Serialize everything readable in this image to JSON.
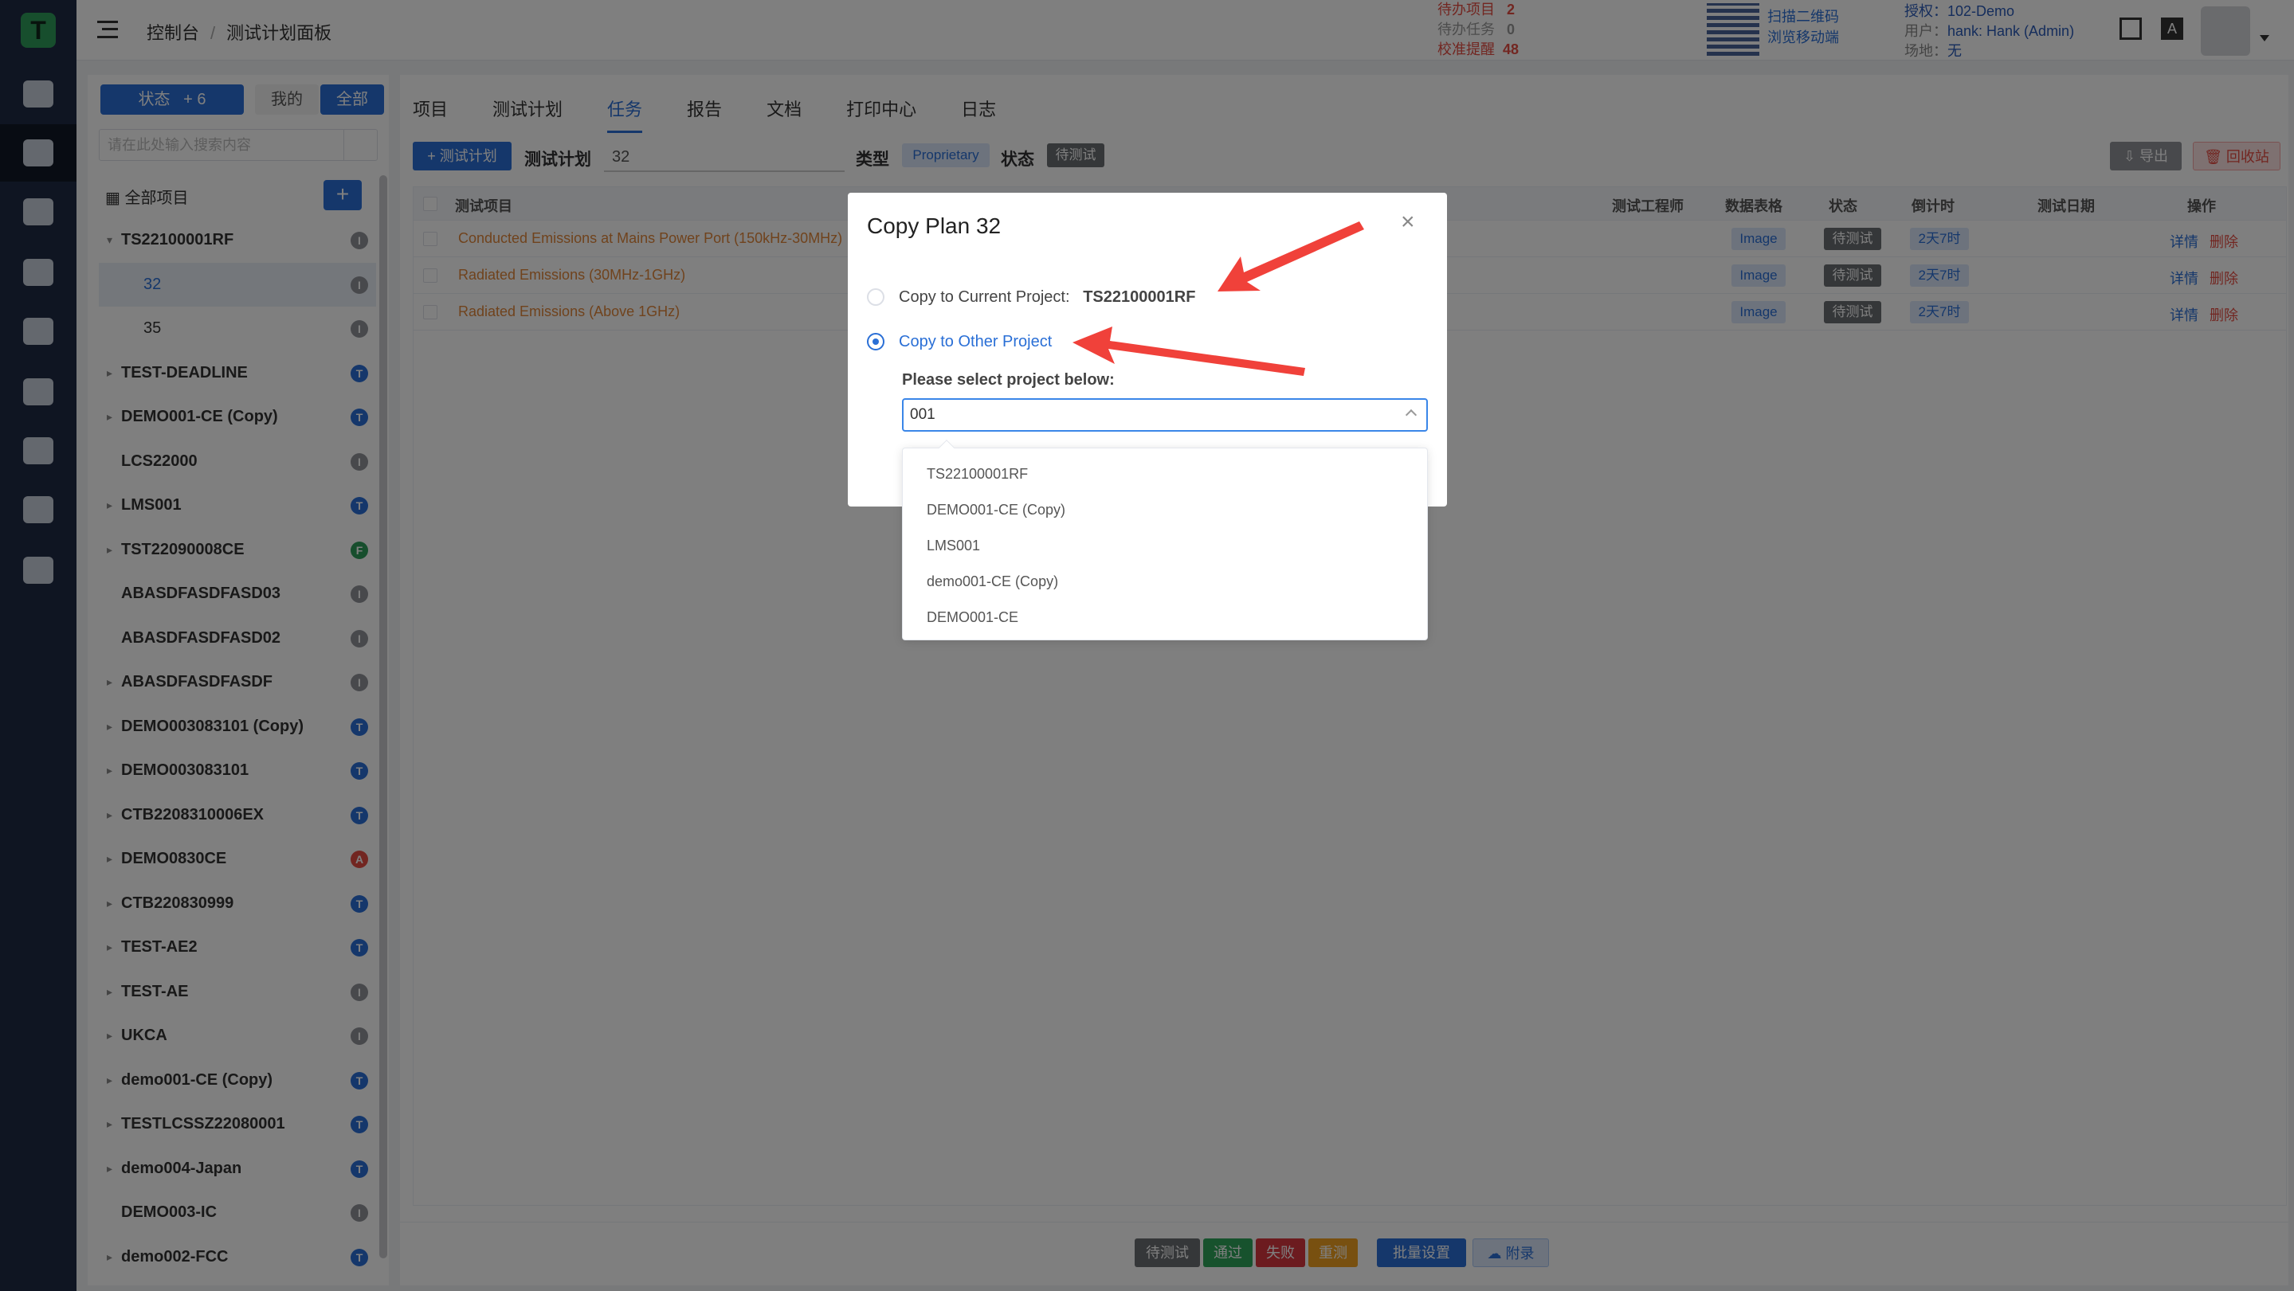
{
  "rail": {
    "logo": "T"
  },
  "header": {
    "breadcrumb": [
      "控制台",
      "测试计划面板"
    ],
    "stats": [
      {
        "label": "待办项目",
        "value": "2"
      },
      {
        "label": "待办任务",
        "value": "0"
      },
      {
        "label": "校准提醒",
        "value": "48"
      }
    ],
    "qr_text": [
      "扫描二维码",
      "浏览移动端"
    ],
    "license": "授权：102-Demo",
    "user_label": "用户：",
    "user_value": "hank: Hank (Admin)",
    "site_label": "场地：",
    "site_value": "无",
    "lang_badge": "A"
  },
  "sidebar": {
    "filter_status": "状态",
    "filter_count": "+ 6",
    "filter_mine": "我的",
    "filter_all": "全部",
    "search_placeholder": "请在此处输入搜索内容",
    "all_projects": "全部项目",
    "add_label": "+",
    "items": [
      {
        "label": "TS22100001RF",
        "badge": "I",
        "color": "#909399",
        "expanded": true
      },
      {
        "label": "32",
        "badge": "I",
        "color": "#909399",
        "child": true,
        "selected": true
      },
      {
        "label": "35",
        "badge": "I",
        "color": "#909399",
        "child": true
      },
      {
        "label": "TEST-DEADLINE",
        "badge": "T",
        "color": "#2a6fd6"
      },
      {
        "label": "DEMO001-CE (Copy)",
        "badge": "T",
        "color": "#2a6fd6"
      },
      {
        "label": "LCS22000",
        "badge": "I",
        "color": "#909399",
        "noarrow": true
      },
      {
        "label": "LMS001",
        "badge": "T",
        "color": "#2a6fd6"
      },
      {
        "label": "TST22090008CE",
        "badge": "F",
        "color": "#2f9d5b"
      },
      {
        "label": "ABASDFASDFASD03",
        "badge": "I",
        "color": "#909399",
        "noarrow": true
      },
      {
        "label": "ABASDFASDFASD02",
        "badge": "I",
        "color": "#909399",
        "noarrow": true
      },
      {
        "label": "ABASDFASDFASDF",
        "badge": "I",
        "color": "#909399"
      },
      {
        "label": "DEMO003083101 (Copy)",
        "badge": "T",
        "color": "#2a6fd6"
      },
      {
        "label": "DEMO003083101",
        "badge": "T",
        "color": "#2a6fd6"
      },
      {
        "label": "CTB2208310006EX",
        "badge": "T",
        "color": "#2a6fd6"
      },
      {
        "label": "DEMO0830CE",
        "badge": "A",
        "color": "#e54d42"
      },
      {
        "label": "CTB220830999",
        "badge": "T",
        "color": "#2a6fd6"
      },
      {
        "label": "TEST-AE2",
        "badge": "T",
        "color": "#2a6fd6"
      },
      {
        "label": "TEST-AE",
        "badge": "I",
        "color": "#909399"
      },
      {
        "label": "UKCA",
        "badge": "I",
        "color": "#909399"
      },
      {
        "label": "demo001-CE (Copy)",
        "badge": "T",
        "color": "#2a6fd6"
      },
      {
        "label": "TESTLCSSZ22080001",
        "badge": "T",
        "color": "#2a6fd6"
      },
      {
        "label": "demo004-Japan",
        "badge": "T",
        "color": "#2a6fd6"
      },
      {
        "label": "DEMO003-IC",
        "badge": "I",
        "color": "#909399",
        "noarrow": true
      },
      {
        "label": "demo002-FCC",
        "badge": "T",
        "color": "#2a6fd6"
      }
    ]
  },
  "main": {
    "tabs": [
      {
        "label": "项目"
      },
      {
        "label": "测试计划"
      },
      {
        "label": "任务",
        "active": true
      },
      {
        "label": "报告"
      },
      {
        "label": "文档"
      },
      {
        "label": "打印中心"
      },
      {
        "label": "日志"
      }
    ],
    "toolbar": {
      "new_plan": "+ 测试计划",
      "plan_label": "测试计划",
      "plan_value": "32",
      "type_label": "类型",
      "type_value": "Proprietary",
      "status_label": "状态",
      "status_value": "待测试",
      "export": "导出",
      "recycle": "回收站"
    },
    "table": {
      "headers": [
        "测试项目",
        "测试工程师",
        "数据表格",
        "状态",
        "倒计时",
        "测试日期",
        "操作"
      ],
      "rows": [
        {
          "name": "Conducted Emissions at Mains Power Port (150kHz-30MHz)",
          "data": "Image",
          "status": "待测试",
          "countdown": "2天7时",
          "detail": "详情",
          "delete": "删除"
        },
        {
          "name": "Radiated Emissions (30MHz-1GHz)",
          "data": "Image",
          "status": "待测试",
          "countdown": "2天7时",
          "detail": "详情",
          "delete": "删除"
        },
        {
          "name": "Radiated Emissions (Above 1GHz)",
          "data": "Image",
          "status": "待测试",
          "countdown": "2天7时",
          "detail": "详情",
          "delete": "删除"
        }
      ]
    },
    "bottom": {
      "pending": "待测试",
      "pass": "通过",
      "fail": "失败",
      "retest": "重测",
      "batch": "批量设置",
      "attach": "附录"
    }
  },
  "modal": {
    "title": "Copy Plan 32",
    "opt1_label": "Copy to Current Project:",
    "opt1_value": "TS22100001RF",
    "opt2_label": "Copy to Other Project",
    "select_label": "Please select project below:",
    "select_value": "001",
    "options": [
      "TS22100001RF",
      "DEMO001-CE (Copy)",
      "LMS001",
      "demo001-CE (Copy)",
      "DEMO001-CE"
    ]
  },
  "colors": {
    "accent": "#2a6fd6",
    "annotation": "#f0413a"
  }
}
